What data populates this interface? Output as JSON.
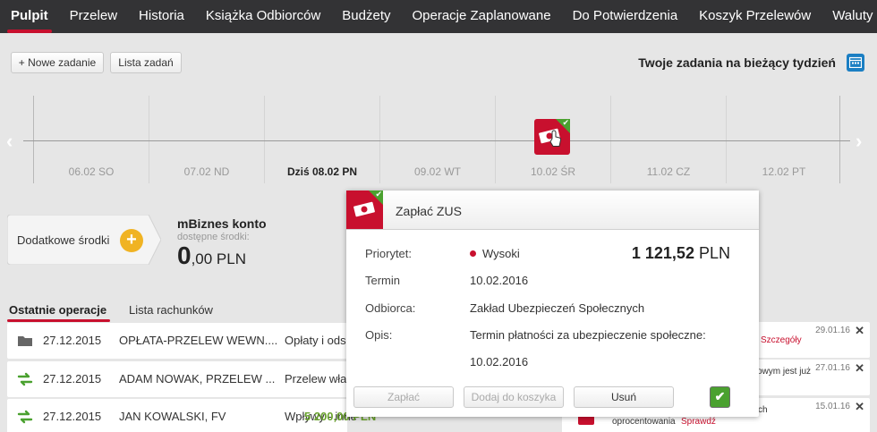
{
  "nav": {
    "tabs": [
      "Pulpit",
      "Przelew",
      "Historia",
      "Książka Odbiorców",
      "Budżety",
      "Operacje Zaplanowane",
      "Do Potwierdzenia",
      "Koszyk Przelewów",
      "Waluty"
    ]
  },
  "toolbar": {
    "new_task": "+ Nowe zadanie",
    "task_list": "Lista zadań",
    "weekly_label": "Twoje zadania na bieżący tydzień",
    "calendar_icon": "calendar-icon"
  },
  "timeline": {
    "days": [
      "06.02 SO",
      "07.02 ND",
      "Dziś 08.02 PN",
      "09.02 WT",
      "10.02 ŚR",
      "11.02 CZ",
      "12.02 PT"
    ],
    "today_index": 2
  },
  "funds": {
    "label": "Dodatkowe środki",
    "plus": "+"
  },
  "account": {
    "name": "mBiznes konto",
    "available_label": "dostępne środki:",
    "balance_int": "0",
    "balance_rest": ",00 PLN"
  },
  "subtabs": {
    "recent": "Ostatnie operacje",
    "accounts": "Lista rachunków"
  },
  "operations": [
    {
      "icon": "folder-icon",
      "date": "27.12.2015",
      "name": "OPŁATA-PRZELEW WEWN....",
      "category": "Opłaty i ods",
      "amount": ""
    },
    {
      "icon": "transfer-arrows-icon",
      "date": "27.12.2015",
      "name": "ADAM NOWAK, PRZELEW ...",
      "category": "Przelew wła",
      "amount": ""
    },
    {
      "icon": "transfer-arrows-icon",
      "date": "27.12.2015",
      "name": "JAN KOWALSKI, FV",
      "category": "Wpływy - inne",
      "amount": "5 200,00 PLN"
    }
  ],
  "notifications": [
    {
      "text": "",
      "link": "Szczegóły",
      "date": "29.01.16"
    },
    {
      "text": "owym jest już",
      "link": "",
      "date": "27.01.16"
    },
    {
      "text": "ch",
      "text2": "oprocentowania",
      "link": "Sprawdź",
      "date": "15.01.16"
    }
  ],
  "popup": {
    "title": "Zapłać ZUS",
    "priority_label": "Priorytet:",
    "priority_value": "Wysoki",
    "amount_value": "1 121,52",
    "amount_currency": "PLN",
    "term_label": "Termin",
    "term_value": "10.02.2016",
    "recipient_label": "Odbiorca:",
    "recipient_value": "Zakład Ubezpieczeń Społecznych",
    "desc_label": "Opis:",
    "desc_value": "Termin płatności za ubezpieczenie społeczne:",
    "desc_value2": "10.02.2016",
    "btn_pay": "Zapłać",
    "btn_basket": "Dodaj do koszyka",
    "btn_delete": "Usuń",
    "btn_done": "✔"
  },
  "colors": {
    "accent": "#c8102e",
    "success": "#4aa12f",
    "nav_bg": "#333335",
    "funds_plus": "#f0b323",
    "calendar": "#1b7fc3"
  }
}
